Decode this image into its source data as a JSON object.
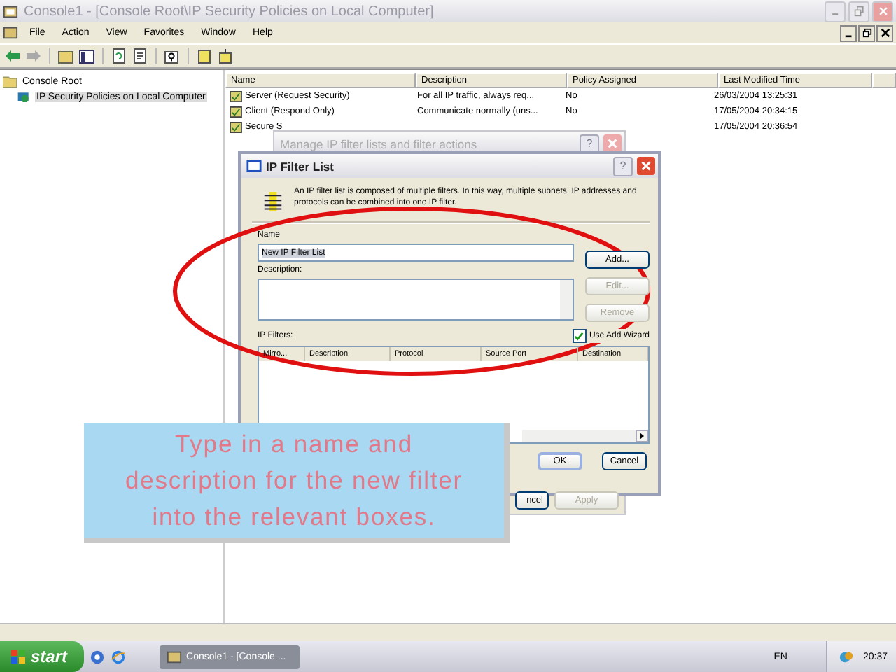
{
  "window": {
    "title": "Console1 - [Console Root\\IP Security Policies on Local Computer]",
    "menu": [
      "File",
      "Action",
      "View",
      "Favorites",
      "Window",
      "Help"
    ]
  },
  "tree": [
    {
      "label": "Console Root",
      "children": [
        {
          "label": "IP Security Policies on Local Computer",
          "selected": true
        }
      ]
    }
  ],
  "list": {
    "columns": [
      "Name",
      "Description",
      "Policy Assigned",
      "Last Modified Time"
    ],
    "rows": [
      {
        "name": "Server (Request Security)",
        "description": "For all IP traffic, always req...",
        "policy_assigned": "No",
        "last_modified": "26/03/2004 13:25:31"
      },
      {
        "name": "Client (Respond Only)",
        "description": "Communicate normally (uns...",
        "policy_assigned": "No",
        "last_modified": "17/05/2004 20:34:15"
      },
      {
        "name": "Secure S",
        "last_modified": "17/05/2004 20:36:54"
      }
    ]
  },
  "back_dialog": {
    "title": "Manage IP filter lists and filter actions",
    "help": "?",
    "buttons": [
      {
        "label": "ncel",
        "disabled": false
      },
      {
        "label": "Apply",
        "disabled": true
      }
    ]
  },
  "dialog": {
    "title": "IP Filter List",
    "help": "?",
    "intro": "An IP filter list is composed of multiple filters. In this way, multiple subnets, IP addresses and protocols can be combined into one IP filter.",
    "name": {
      "label": "Name",
      "value": "New IP Filter List"
    },
    "description": {
      "label": "Description:"
    },
    "side_buttons": [
      {
        "label": "Add...",
        "disabled": false
      },
      {
        "label": "Edit...",
        "disabled": true
      },
      {
        "label": "Remove",
        "disabled": true
      }
    ],
    "filters": {
      "label": "IP Filters:",
      "columns": [
        "Mirro...",
        "Description",
        "Protocol",
        "Source Port",
        "Destination"
      ]
    },
    "use_wizard": {
      "label": "Use Add Wizard",
      "checked": true
    },
    "footer_buttons": [
      "OK",
      "Cancel"
    ]
  },
  "caption": "Type in a name and description for the new filter into the relevant boxes.",
  "taskbar": {
    "start": "start",
    "tasks": [
      {
        "label": "Console1 - [Console ...",
        "selected": true
      }
    ],
    "language": "EN",
    "clock": "20:37"
  }
}
